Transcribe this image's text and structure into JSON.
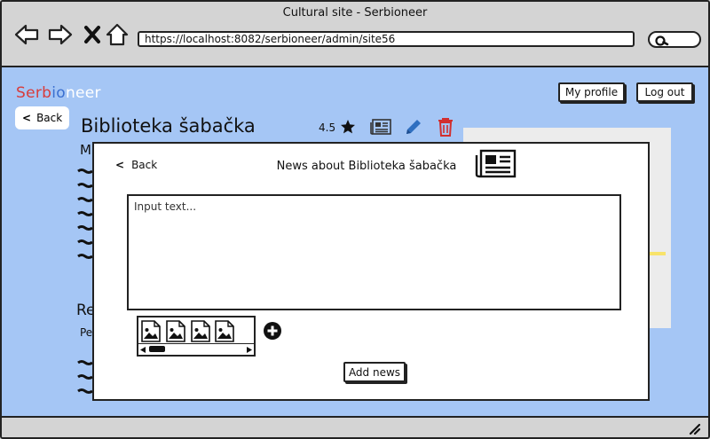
{
  "window": {
    "title": "Cultural site - Serbioneer"
  },
  "browser": {
    "url": "https://localhost:8082/serbioneer/admin/site56",
    "back_icon": "arrow-left-icon",
    "forward_icon": "arrow-right-icon",
    "stop_icon": "close-icon",
    "home_icon": "home-icon",
    "search_icon": "search-icon"
  },
  "header": {
    "brand_part1": "Serb",
    "brand_part2": "io",
    "brand_part3": "neer",
    "profile_label": "My profile",
    "logout_label": "Log out"
  },
  "site": {
    "back_label": "Back",
    "title": "Biblioteka šabačka",
    "rating": "4.5",
    "peek_line1": "M",
    "peek_heading": "Re",
    "peek_line2": "Pe"
  },
  "modal": {
    "back_label": "Back",
    "title": "News about Biblioteka šabačka",
    "placeholder": "Input text...",
    "add_button_label": "Add news"
  },
  "colors": {
    "page_bg": "#a5c6f5",
    "brand_red": "#d83c3c",
    "brand_blue": "#3a6fd0",
    "edit_blue": "#2f6fc0",
    "delete_red": "#d22f2f"
  }
}
